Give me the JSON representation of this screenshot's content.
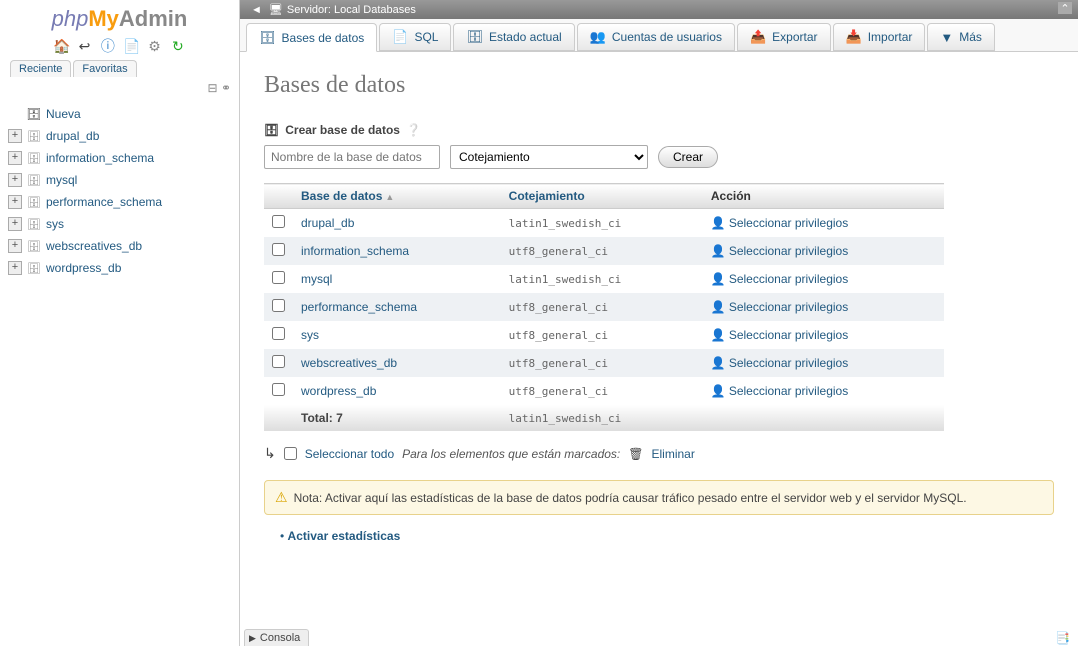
{
  "logo": {
    "php": "php",
    "my": "My",
    "admin": "Admin"
  },
  "sidebar": {
    "tabs": {
      "recent": "Reciente",
      "favorites": "Favoritas"
    },
    "new_label": "Nueva",
    "items": [
      {
        "label": "drupal_db"
      },
      {
        "label": "information_schema"
      },
      {
        "label": "mysql"
      },
      {
        "label": "performance_schema"
      },
      {
        "label": "sys"
      },
      {
        "label": "webscreatives_db"
      },
      {
        "label": "wordpress_db"
      }
    ]
  },
  "breadcrumb": {
    "server_label": "Servidor:",
    "server_name": "Local Databases"
  },
  "tabs": [
    {
      "label": "Bases de datos",
      "icon": "🗄",
      "active": true
    },
    {
      "label": "SQL",
      "icon": "📄"
    },
    {
      "label": "Estado actual",
      "icon": "🗄"
    },
    {
      "label": "Cuentas de usuarios",
      "icon": "👥"
    },
    {
      "label": "Exportar",
      "icon": "📤"
    },
    {
      "label": "Importar",
      "icon": "📥"
    },
    {
      "label": "Más",
      "icon": "▼"
    }
  ],
  "page": {
    "title": "Bases de datos",
    "create_label": "Crear base de datos",
    "db_name_placeholder": "Nombre de la base de datos",
    "collation_placeholder": "Cotejamiento",
    "create_button": "Crear"
  },
  "table": {
    "headers": {
      "database": "Base de datos",
      "collation": "Cotejamiento",
      "action": "Acción"
    },
    "rows": [
      {
        "name": "drupal_db",
        "collation": "latin1_swedish_ci",
        "action": "Seleccionar privilegios"
      },
      {
        "name": "information_schema",
        "collation": "utf8_general_ci",
        "action": "Seleccionar privilegios"
      },
      {
        "name": "mysql",
        "collation": "latin1_swedish_ci",
        "action": "Seleccionar privilegios"
      },
      {
        "name": "performance_schema",
        "collation": "utf8_general_ci",
        "action": "Seleccionar privilegios"
      },
      {
        "name": "sys",
        "collation": "utf8_general_ci",
        "action": "Seleccionar privilegios"
      },
      {
        "name": "webscreatives_db",
        "collation": "utf8_general_ci",
        "action": "Seleccionar privilegios"
      },
      {
        "name": "wordpress_db",
        "collation": "utf8_general_ci",
        "action": "Seleccionar privilegios"
      }
    ],
    "total": {
      "label": "Total: 7",
      "collation": "latin1_swedish_ci"
    }
  },
  "check_all": {
    "label": "Seleccionar todo",
    "with_selected": "Para los elementos que están marcados:",
    "delete": "Eliminar"
  },
  "notice": "Nota: Activar aquí las estadísticas de la base de datos podría causar tráfico pesado entre el servidor web y el servidor MySQL.",
  "enable_stats": "Activar estadísticas",
  "console": "Consola"
}
